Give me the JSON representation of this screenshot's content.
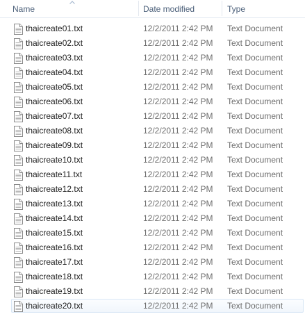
{
  "columns": {
    "name": "Name",
    "date_modified": "Date modified",
    "type": "Type"
  },
  "sort": {
    "column": "name",
    "direction": "ascending"
  },
  "files": [
    {
      "name": "thaicreate01.txt",
      "date": "12/2/2011 2:42 PM",
      "type": "Text Document"
    },
    {
      "name": "thaicreate02.txt",
      "date": "12/2/2011 2:42 PM",
      "type": "Text Document"
    },
    {
      "name": "thaicreate03.txt",
      "date": "12/2/2011 2:42 PM",
      "type": "Text Document"
    },
    {
      "name": "thaicreate04.txt",
      "date": "12/2/2011 2:42 PM",
      "type": "Text Document"
    },
    {
      "name": "thaicreate05.txt",
      "date": "12/2/2011 2:42 PM",
      "type": "Text Document"
    },
    {
      "name": "thaicreate06.txt",
      "date": "12/2/2011 2:42 PM",
      "type": "Text Document"
    },
    {
      "name": "thaicreate07.txt",
      "date": "12/2/2011 2:42 PM",
      "type": "Text Document"
    },
    {
      "name": "thaicreate08.txt",
      "date": "12/2/2011 2:42 PM",
      "type": "Text Document"
    },
    {
      "name": "thaicreate09.txt",
      "date": "12/2/2011 2:42 PM",
      "type": "Text Document"
    },
    {
      "name": "thaicreate10.txt",
      "date": "12/2/2011 2:42 PM",
      "type": "Text Document"
    },
    {
      "name": "thaicreate11.txt",
      "date": "12/2/2011 2:42 PM",
      "type": "Text Document"
    },
    {
      "name": "thaicreate12.txt",
      "date": "12/2/2011 2:42 PM",
      "type": "Text Document"
    },
    {
      "name": "thaicreate13.txt",
      "date": "12/2/2011 2:42 PM",
      "type": "Text Document"
    },
    {
      "name": "thaicreate14.txt",
      "date": "12/2/2011 2:42 PM",
      "type": "Text Document"
    },
    {
      "name": "thaicreate15.txt",
      "date": "12/2/2011 2:42 PM",
      "type": "Text Document"
    },
    {
      "name": "thaicreate16.txt",
      "date": "12/2/2011 2:42 PM",
      "type": "Text Document"
    },
    {
      "name": "thaicreate17.txt",
      "date": "12/2/2011 2:42 PM",
      "type": "Text Document"
    },
    {
      "name": "thaicreate18.txt",
      "date": "12/2/2011 2:42 PM",
      "type": "Text Document"
    },
    {
      "name": "thaicreate19.txt",
      "date": "12/2/2011 2:42 PM",
      "type": "Text Document"
    },
    {
      "name": "thaicreate20.txt",
      "date": "12/2/2011 2:42 PM",
      "type": "Text Document",
      "selected": true
    }
  ],
  "icons": {
    "file": "text-document-icon",
    "sort": "sort-ascending-icon"
  },
  "colors": {
    "header_text": "#4c607a",
    "secondary_text": "#6d6d6d",
    "selection_border": "#d8e6f5"
  }
}
